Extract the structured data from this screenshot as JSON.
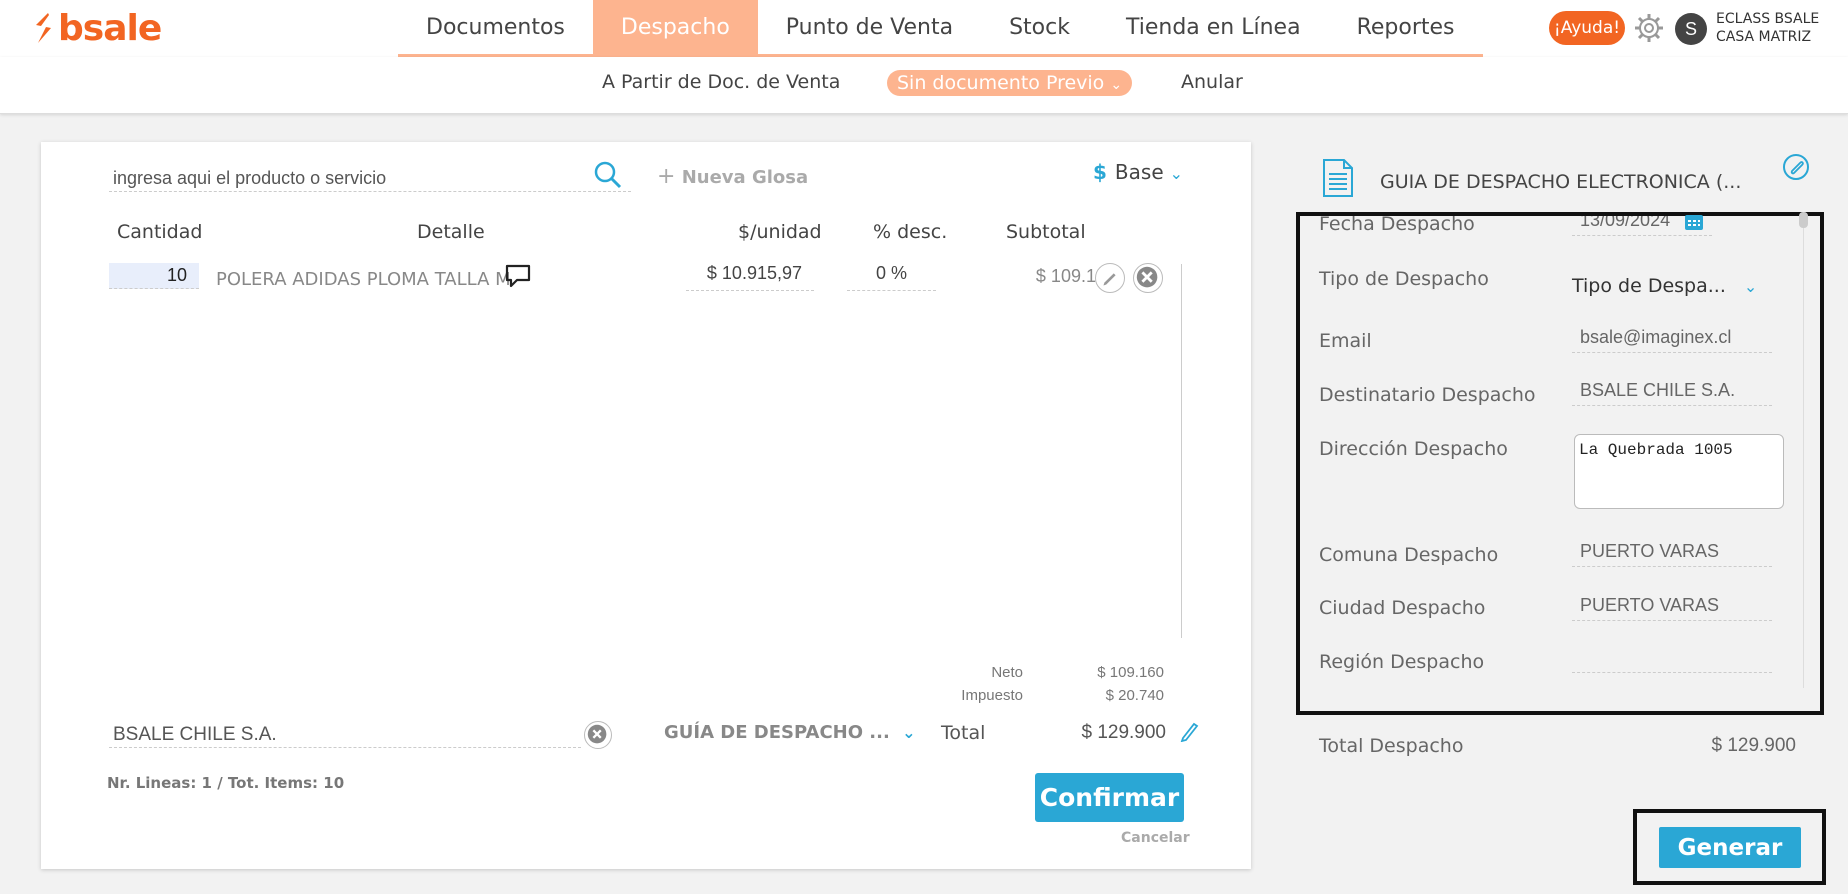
{
  "brand": {
    "name": "bsale",
    "color": "#f26522"
  },
  "nav": {
    "items": [
      "Documentos",
      "Despacho",
      "Punto de Venta",
      "Stock",
      "Tienda en Línea",
      "Reportes"
    ],
    "active": "Despacho"
  },
  "header": {
    "help_label": "¡Ayuda!",
    "avatar_initial": "S",
    "user_company": "ECLASS BSALE",
    "user_branch": "CASA MATRIZ"
  },
  "subnav": {
    "from_sale": "A Partir de Doc. de Venta",
    "no_previous": "Sin documento Previo",
    "cancel": "Anular"
  },
  "editor": {
    "search_value": "ingresa aqui el producto o servicio",
    "new_gloss": "Nueva Glosa",
    "price_list": "Base",
    "columns": {
      "qty": "Cantidad",
      "detail": "Detalle",
      "unit_price": "$/unidad",
      "discount": "% desc.",
      "subtotal": "Subtotal"
    },
    "lines": [
      {
        "qty": "10",
        "detail": "POLERA ADIDAS PLOMA TALLA M",
        "unit_price": "$ 10.915,97",
        "discount": "0 %",
        "subtotal": "$ 109.160"
      }
    ],
    "summary": {
      "net_label": "Neto",
      "net_value": "$ 109.160",
      "tax_label": "Impuesto",
      "tax_value": "$ 20.740",
      "total_label": "Total",
      "total_value": "$ 129.900"
    },
    "client": "BSALE CHILE S.A.",
    "doc_type": "GUÍA DE DESPACHO ...",
    "counts": "Nr. Lineas: 1 / Tot. Items: 10",
    "confirm": "Confirmar",
    "cancel": "Cancelar"
  },
  "dispatch": {
    "title": "GUIA DE DESPACHO ELECTRONICA (...",
    "fields": {
      "date_label": "Fecha Despacho",
      "date_value": "13/09/2024",
      "type_label": "Tipo de Despacho",
      "type_value": "Tipo de Despa...",
      "email_label": "Email",
      "email_value": "bsale@imaginex.cl",
      "recipient_label": "Destinatario Despacho",
      "recipient_value": "BSALE CHILE S.A.",
      "address_label": "Dirección Despacho",
      "address_value": "La Quebrada 1005",
      "comuna_label": "Comuna Despacho",
      "comuna_value": "PUERTO VARAS",
      "city_label": "Ciudad Despacho",
      "city_value": "PUERTO VARAS",
      "region_label": "Región Despacho",
      "region_value": ""
    },
    "total_label": "Total Despacho",
    "total_value": "$ 129.900",
    "generate": "Generar"
  },
  "colors": {
    "accent": "#2aa7d5",
    "nav_active": "#fdb48f",
    "help": "#f26522"
  }
}
